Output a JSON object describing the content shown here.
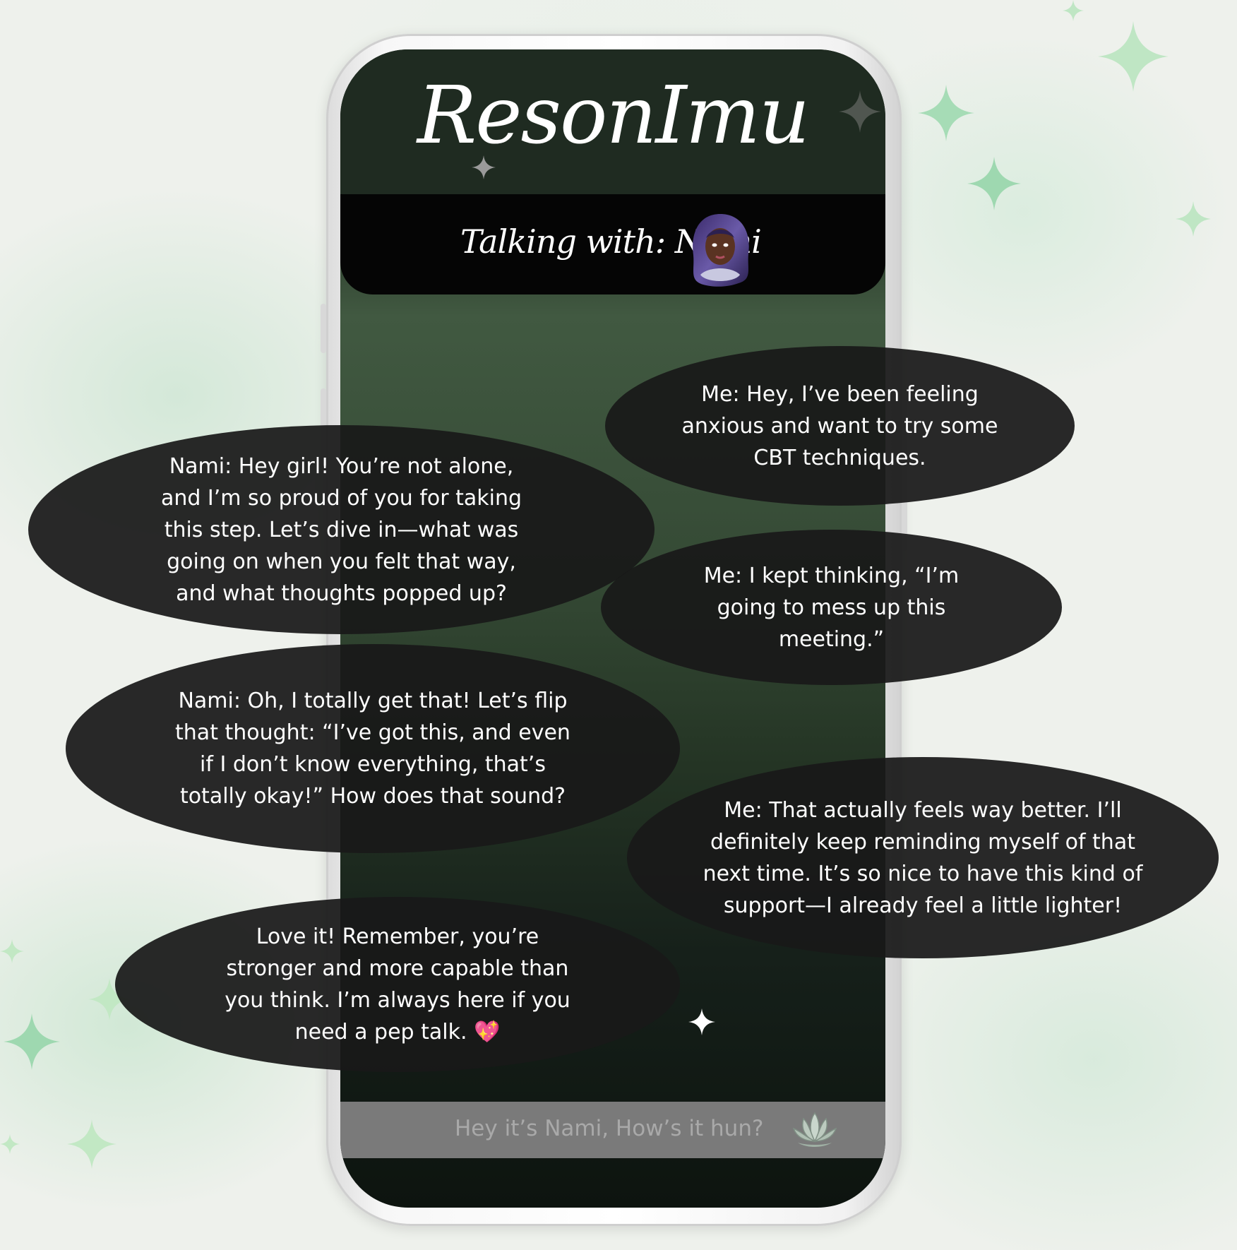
{
  "app": {
    "title": "ResonImu",
    "talking_with": "Talking with: Nami",
    "input_placeholder": "Hey it’s Nami, How’s it hun?"
  },
  "messages": [
    {
      "sender": "me",
      "text": "Me: Hey, I’ve been feeling anxious and want to try some CBT techniques."
    },
    {
      "sender": "nami",
      "text": "Nami: Hey girl! You’re not alone, and I’m so proud of you for taking this step. Let’s dive in—what was going on when you felt that way, and what thoughts popped up?"
    },
    {
      "sender": "me",
      "text": "Me: I kept thinking, “I’m going to mess up this meeting.”"
    },
    {
      "sender": "nami",
      "text": "Nami: Oh, I totally get that! Let’s flip that thought: “I’ve got this, and even if I don’t know everything, that’s totally okay!” How does that sound?"
    },
    {
      "sender": "me",
      "text": "Me: That actually feels way better. I’ll definitely keep reminding myself of that next time. It’s so nice to have this kind of support—I already feel a little lighter!"
    },
    {
      "sender": "nami",
      "text": "Love it! Remember, you’re stronger and more capable than you think. I’m always here if you need a pep talk.",
      "emoji": "💖"
    }
  ],
  "colors": {
    "sparkle": "#a8dcb8",
    "bubble": "#191919",
    "header": "#1f2b21",
    "input_bar": "#7a7a7a"
  },
  "icons": [
    "sparkle-icon",
    "avatar-nami",
    "lotus-icon",
    "heart-icon"
  ]
}
